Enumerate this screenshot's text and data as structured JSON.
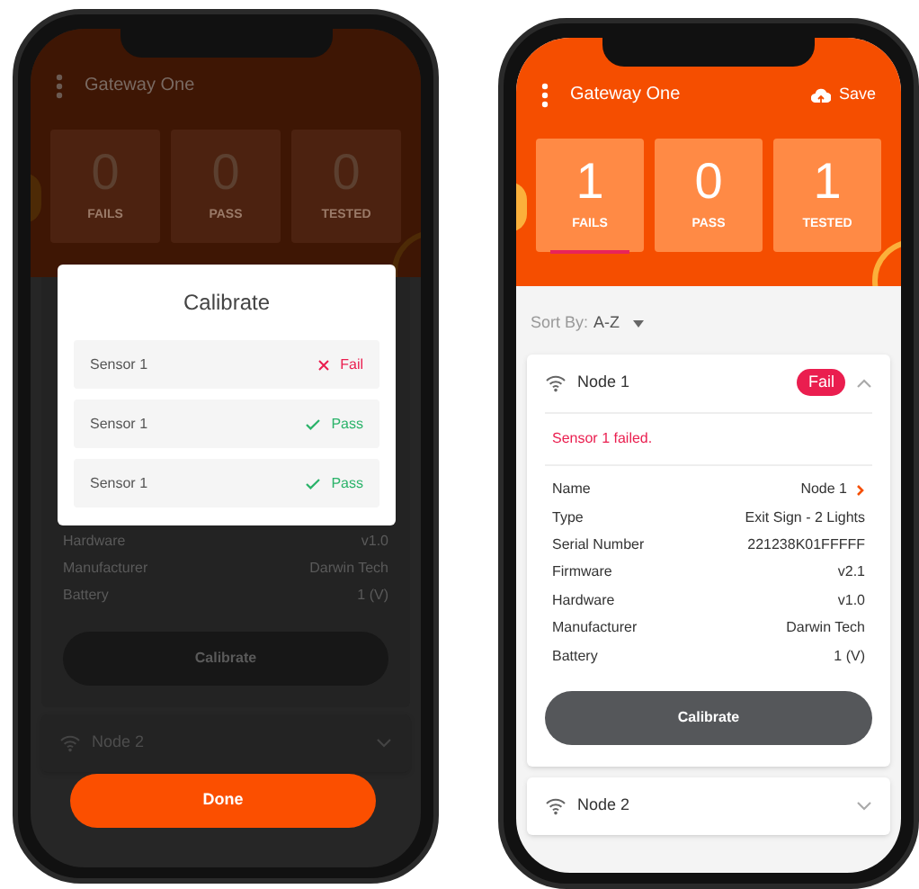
{
  "phones": [
    {
      "dimmed": true,
      "title": "Gateway One",
      "counters": [
        {
          "value": "0",
          "label": "FAILS",
          "selected": false
        },
        {
          "value": "0",
          "label": "PASS",
          "selected": false
        },
        {
          "value": "0",
          "label": "TESTED",
          "selected": false
        }
      ],
      "details": [
        {
          "label": "Hardware",
          "value": "v1.0"
        },
        {
          "label": "Manufacturer",
          "value": "Darwin Tech"
        },
        {
          "label": "Battery",
          "value": "1 (V)"
        }
      ],
      "calibrate_button": "Calibrate",
      "nodes": [
        {
          "name": "Node 2",
          "expanded": false
        }
      ],
      "dialog": {
        "title": "Calibrate",
        "sensors": [
          {
            "name": "Sensor 1",
            "result": "Fail",
            "passed": false
          },
          {
            "name": "Sensor 1",
            "result": "Pass",
            "passed": true
          },
          {
            "name": "Sensor 1",
            "result": "Pass",
            "passed": true
          }
        ]
      },
      "done_button": "Done"
    },
    {
      "dimmed": false,
      "title": "Gateway One",
      "save_button": "Save",
      "counters": [
        {
          "value": "1",
          "label": "FAILS",
          "selected": true
        },
        {
          "value": "0",
          "label": "PASS",
          "selected": false
        },
        {
          "value": "1",
          "label": "TESTED",
          "selected": false
        }
      ],
      "sort": {
        "label": "Sort By:",
        "value": "A-Z"
      },
      "nodes": [
        {
          "name": "Node 1",
          "expanded": true,
          "badge": "Fail",
          "error": "Sensor 1 failed.",
          "details": [
            {
              "label": "Name",
              "value": "Node 1",
              "link": true
            },
            {
              "label": "Type",
              "value": "Exit Sign - 2 Lights"
            },
            {
              "label": "Serial Number",
              "value": "221238K01FFFFF"
            },
            {
              "label": "Firmware",
              "value": "v2.1"
            },
            {
              "label": "Hardware",
              "value": "v1.0"
            },
            {
              "label": "Manufacturer",
              "value": "Darwin Tech"
            },
            {
              "label": "Battery",
              "value": "1 (V)"
            }
          ],
          "calibrate_button": "Calibrate"
        },
        {
          "name": "Node 2",
          "expanded": false
        }
      ]
    }
  ]
}
